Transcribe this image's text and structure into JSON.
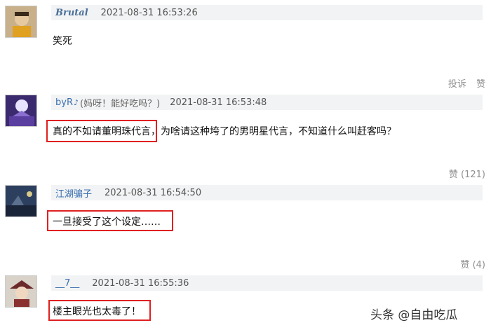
{
  "comments": [
    {
      "username": "Brutal",
      "extra": "",
      "time": "2021-08-31 16:53:26",
      "content": "笑死",
      "actions": {
        "report": "投诉",
        "like": "赞"
      }
    },
    {
      "username": "byR",
      "extra": "(妈呀！能好吃吗？)",
      "time": "2021-08-31 16:53:48",
      "content": "真的不如请董明珠代言，为啥请这种垮了的男明星代言，不知道什么叫赶客吗？",
      "actions": {
        "like": "赞 (121)"
      }
    },
    {
      "username": "江湖骗子",
      "extra": "",
      "time": "2021-08-31 16:54:50",
      "content": "一旦接受了这个设定……",
      "actions": {
        "like": "赞 (4)"
      }
    },
    {
      "username": "__7__",
      "extra": "",
      "time": "2021-08-31 16:55:36",
      "content": "楼主眼光也太毒了！",
      "actions": {}
    }
  ],
  "watermark": "头条 @自由吃瓜",
  "colors": {
    "highlight": "#e02020",
    "username": "#3a6fb0",
    "header_bg": "#f2f3f4"
  }
}
